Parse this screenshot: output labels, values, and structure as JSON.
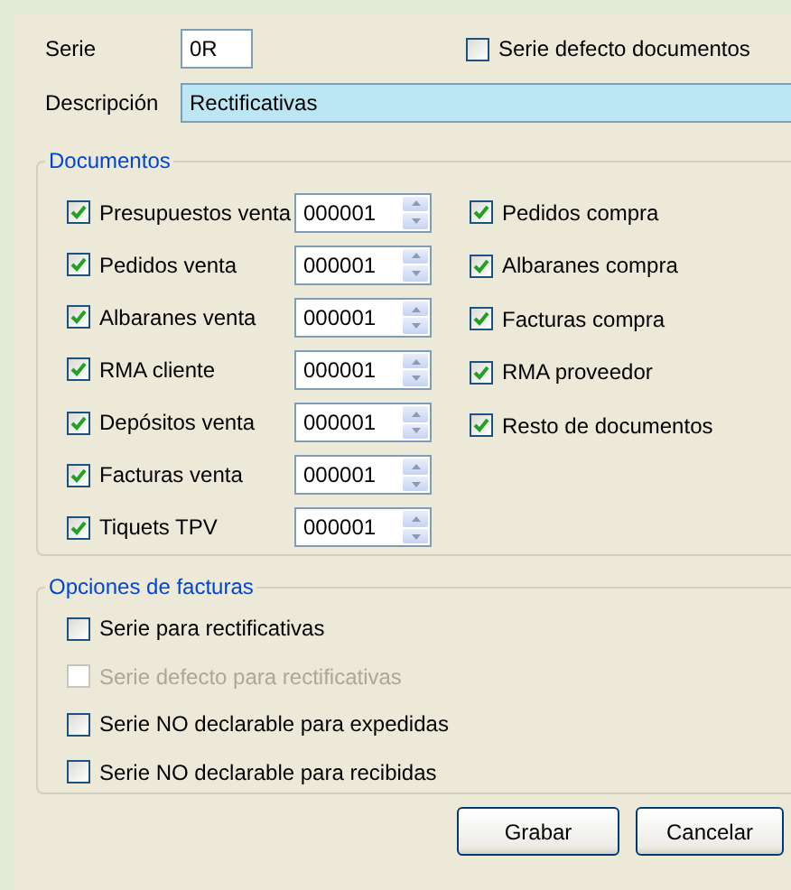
{
  "serie": {
    "label": "Serie",
    "value": "0R"
  },
  "default_series": {
    "label": "Serie defecto documentos",
    "checked": false
  },
  "description": {
    "label": "Descripción",
    "value": "Rectificativas",
    "focused": true
  },
  "documents": {
    "title": "Documentos",
    "sales": [
      {
        "label": "Presupuestos venta",
        "checked": true,
        "counter": "000001"
      },
      {
        "label": "Pedidos venta",
        "checked": true,
        "counter": "000001"
      },
      {
        "label": "Albaranes venta",
        "checked": true,
        "counter": "000001"
      },
      {
        "label": "RMA cliente",
        "checked": true,
        "counter": "000001"
      },
      {
        "label": "Depósitos venta",
        "checked": true,
        "counter": "000001"
      },
      {
        "label": "Facturas venta",
        "checked": true,
        "counter": "000001"
      },
      {
        "label": "Tiquets TPV",
        "checked": true,
        "counter": "000001"
      }
    ],
    "purchases": [
      {
        "label": "Pedidos compra",
        "checked": true
      },
      {
        "label": "Albaranes compra",
        "checked": true
      },
      {
        "label": "Facturas compra",
        "checked": true
      },
      {
        "label": "RMA proveedor",
        "checked": true
      },
      {
        "label": "Resto de documentos",
        "checked": true
      }
    ]
  },
  "invoice_options": {
    "title": "Opciones de facturas",
    "items": [
      {
        "label": "Serie para rectificativas",
        "checked": false,
        "disabled": false
      },
      {
        "label": "Serie defecto para rectificativas",
        "checked": false,
        "disabled": true
      },
      {
        "label": "Serie NO declarable para expedidas",
        "checked": false,
        "disabled": false
      },
      {
        "label": "Serie NO declarable para recibidas",
        "checked": false,
        "disabled": false
      }
    ]
  },
  "buttons": [
    {
      "label": "Grabar"
    },
    {
      "label": "Cancelar"
    }
  ]
}
